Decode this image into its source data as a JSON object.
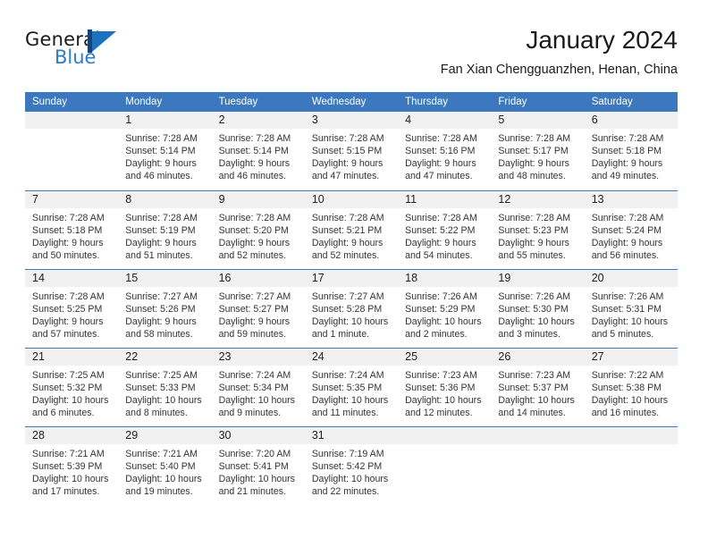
{
  "brand": {
    "word_one": "General",
    "word_two": "Blue",
    "mark_name": "general-blue-logo"
  },
  "header": {
    "title": "January 2024",
    "subtitle": "Fan Xian Chengguanzhen, Henan, China"
  },
  "colors": {
    "header_blue": "#3c78be",
    "brand_blue": "#2e7cc4",
    "brand_dark_blue": "#13447e",
    "day_band_gray": "#f1f1f1"
  },
  "calendar": {
    "day_names": [
      "Sunday",
      "Monday",
      "Tuesday",
      "Wednesday",
      "Thursday",
      "Friday",
      "Saturday"
    ],
    "weeks": [
      [
        {
          "day": "",
          "empty": true
        },
        {
          "day": "1",
          "sunrise": "Sunrise: 7:28 AM",
          "sunset": "Sunset: 5:14 PM",
          "daylight_1": "Daylight: 9 hours",
          "daylight_2": "and 46 minutes."
        },
        {
          "day": "2",
          "sunrise": "Sunrise: 7:28 AM",
          "sunset": "Sunset: 5:14 PM",
          "daylight_1": "Daylight: 9 hours",
          "daylight_2": "and 46 minutes."
        },
        {
          "day": "3",
          "sunrise": "Sunrise: 7:28 AM",
          "sunset": "Sunset: 5:15 PM",
          "daylight_1": "Daylight: 9 hours",
          "daylight_2": "and 47 minutes."
        },
        {
          "day": "4",
          "sunrise": "Sunrise: 7:28 AM",
          "sunset": "Sunset: 5:16 PM",
          "daylight_1": "Daylight: 9 hours",
          "daylight_2": "and 47 minutes."
        },
        {
          "day": "5",
          "sunrise": "Sunrise: 7:28 AM",
          "sunset": "Sunset: 5:17 PM",
          "daylight_1": "Daylight: 9 hours",
          "daylight_2": "and 48 minutes."
        },
        {
          "day": "6",
          "sunrise": "Sunrise: 7:28 AM",
          "sunset": "Sunset: 5:18 PM",
          "daylight_1": "Daylight: 9 hours",
          "daylight_2": "and 49 minutes."
        }
      ],
      [
        {
          "day": "7",
          "sunrise": "Sunrise: 7:28 AM",
          "sunset": "Sunset: 5:18 PM",
          "daylight_1": "Daylight: 9 hours",
          "daylight_2": "and 50 minutes."
        },
        {
          "day": "8",
          "sunrise": "Sunrise: 7:28 AM",
          "sunset": "Sunset: 5:19 PM",
          "daylight_1": "Daylight: 9 hours",
          "daylight_2": "and 51 minutes."
        },
        {
          "day": "9",
          "sunrise": "Sunrise: 7:28 AM",
          "sunset": "Sunset: 5:20 PM",
          "daylight_1": "Daylight: 9 hours",
          "daylight_2": "and 52 minutes."
        },
        {
          "day": "10",
          "sunrise": "Sunrise: 7:28 AM",
          "sunset": "Sunset: 5:21 PM",
          "daylight_1": "Daylight: 9 hours",
          "daylight_2": "and 52 minutes."
        },
        {
          "day": "11",
          "sunrise": "Sunrise: 7:28 AM",
          "sunset": "Sunset: 5:22 PM",
          "daylight_1": "Daylight: 9 hours",
          "daylight_2": "and 54 minutes."
        },
        {
          "day": "12",
          "sunrise": "Sunrise: 7:28 AM",
          "sunset": "Sunset: 5:23 PM",
          "daylight_1": "Daylight: 9 hours",
          "daylight_2": "and 55 minutes."
        },
        {
          "day": "13",
          "sunrise": "Sunrise: 7:28 AM",
          "sunset": "Sunset: 5:24 PM",
          "daylight_1": "Daylight: 9 hours",
          "daylight_2": "and 56 minutes."
        }
      ],
      [
        {
          "day": "14",
          "sunrise": "Sunrise: 7:28 AM",
          "sunset": "Sunset: 5:25 PM",
          "daylight_1": "Daylight: 9 hours",
          "daylight_2": "and 57 minutes."
        },
        {
          "day": "15",
          "sunrise": "Sunrise: 7:27 AM",
          "sunset": "Sunset: 5:26 PM",
          "daylight_1": "Daylight: 9 hours",
          "daylight_2": "and 58 minutes."
        },
        {
          "day": "16",
          "sunrise": "Sunrise: 7:27 AM",
          "sunset": "Sunset: 5:27 PM",
          "daylight_1": "Daylight: 9 hours",
          "daylight_2": "and 59 minutes."
        },
        {
          "day": "17",
          "sunrise": "Sunrise: 7:27 AM",
          "sunset": "Sunset: 5:28 PM",
          "daylight_1": "Daylight: 10 hours",
          "daylight_2": "and 1 minute."
        },
        {
          "day": "18",
          "sunrise": "Sunrise: 7:26 AM",
          "sunset": "Sunset: 5:29 PM",
          "daylight_1": "Daylight: 10 hours",
          "daylight_2": "and 2 minutes."
        },
        {
          "day": "19",
          "sunrise": "Sunrise: 7:26 AM",
          "sunset": "Sunset: 5:30 PM",
          "daylight_1": "Daylight: 10 hours",
          "daylight_2": "and 3 minutes."
        },
        {
          "day": "20",
          "sunrise": "Sunrise: 7:26 AM",
          "sunset": "Sunset: 5:31 PM",
          "daylight_1": "Daylight: 10 hours",
          "daylight_2": "and 5 minutes."
        }
      ],
      [
        {
          "day": "21",
          "sunrise": "Sunrise: 7:25 AM",
          "sunset": "Sunset: 5:32 PM",
          "daylight_1": "Daylight: 10 hours",
          "daylight_2": "and 6 minutes."
        },
        {
          "day": "22",
          "sunrise": "Sunrise: 7:25 AM",
          "sunset": "Sunset: 5:33 PM",
          "daylight_1": "Daylight: 10 hours",
          "daylight_2": "and 8 minutes."
        },
        {
          "day": "23",
          "sunrise": "Sunrise: 7:24 AM",
          "sunset": "Sunset: 5:34 PM",
          "daylight_1": "Daylight: 10 hours",
          "daylight_2": "and 9 minutes."
        },
        {
          "day": "24",
          "sunrise": "Sunrise: 7:24 AM",
          "sunset": "Sunset: 5:35 PM",
          "daylight_1": "Daylight: 10 hours",
          "daylight_2": "and 11 minutes."
        },
        {
          "day": "25",
          "sunrise": "Sunrise: 7:23 AM",
          "sunset": "Sunset: 5:36 PM",
          "daylight_1": "Daylight: 10 hours",
          "daylight_2": "and 12 minutes."
        },
        {
          "day": "26",
          "sunrise": "Sunrise: 7:23 AM",
          "sunset": "Sunset: 5:37 PM",
          "daylight_1": "Daylight: 10 hours",
          "daylight_2": "and 14 minutes."
        },
        {
          "day": "27",
          "sunrise": "Sunrise: 7:22 AM",
          "sunset": "Sunset: 5:38 PM",
          "daylight_1": "Daylight: 10 hours",
          "daylight_2": "and 16 minutes."
        }
      ],
      [
        {
          "day": "28",
          "sunrise": "Sunrise: 7:21 AM",
          "sunset": "Sunset: 5:39 PM",
          "daylight_1": "Daylight: 10 hours",
          "daylight_2": "and 17 minutes."
        },
        {
          "day": "29",
          "sunrise": "Sunrise: 7:21 AM",
          "sunset": "Sunset: 5:40 PM",
          "daylight_1": "Daylight: 10 hours",
          "daylight_2": "and 19 minutes."
        },
        {
          "day": "30",
          "sunrise": "Sunrise: 7:20 AM",
          "sunset": "Sunset: 5:41 PM",
          "daylight_1": "Daylight: 10 hours",
          "daylight_2": "and 21 minutes."
        },
        {
          "day": "31",
          "sunrise": "Sunrise: 7:19 AM",
          "sunset": "Sunset: 5:42 PM",
          "daylight_1": "Daylight: 10 hours",
          "daylight_2": "and 22 minutes."
        },
        {
          "day": "",
          "empty": true
        },
        {
          "day": "",
          "empty": true
        },
        {
          "day": "",
          "empty": true
        }
      ]
    ]
  }
}
